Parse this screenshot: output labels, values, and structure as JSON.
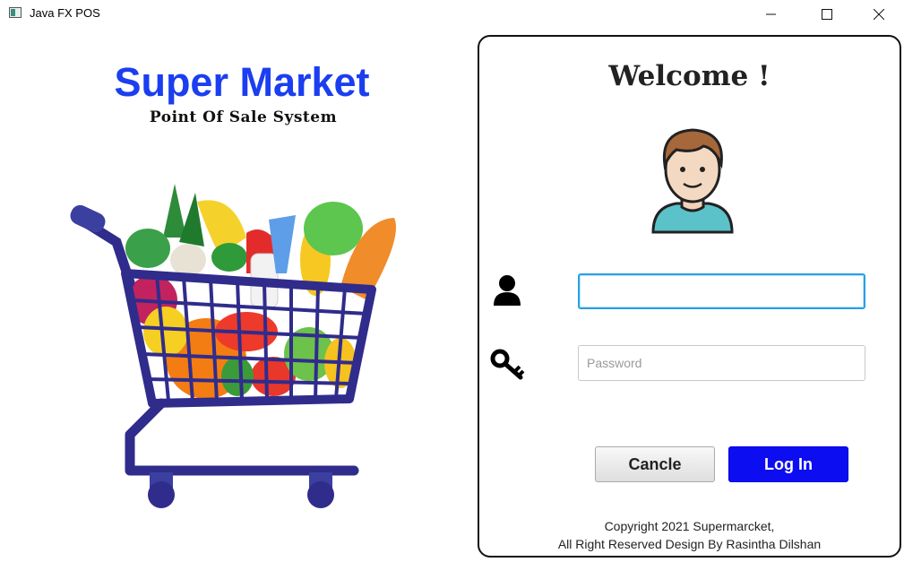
{
  "window": {
    "title": "Java FX POS",
    "controls": {
      "minimize_icon": "minimize-icon",
      "maximize_icon": "maximize-icon",
      "close_icon": "close-icon"
    }
  },
  "branding": {
    "title": "Super Market",
    "subtitle": "Point Of Sale System",
    "title_color": "#1b3ef0",
    "illustration": "grocery-cart-icon"
  },
  "login": {
    "heading": "Welcome !",
    "avatar": "user-avatar-icon",
    "username_icon": "person-icon",
    "password_icon": "key-icon",
    "username": {
      "value": "",
      "placeholder": ""
    },
    "password": {
      "value": "",
      "placeholder": "Password"
    },
    "cancel_label": "Cancle",
    "login_label": "Log In",
    "login_color": "#0d0df2",
    "footer_line1": "Copyright 2021 Supermarcket,",
    "footer_line2": "All Right Reserved Design By Rasintha Dilshan"
  }
}
